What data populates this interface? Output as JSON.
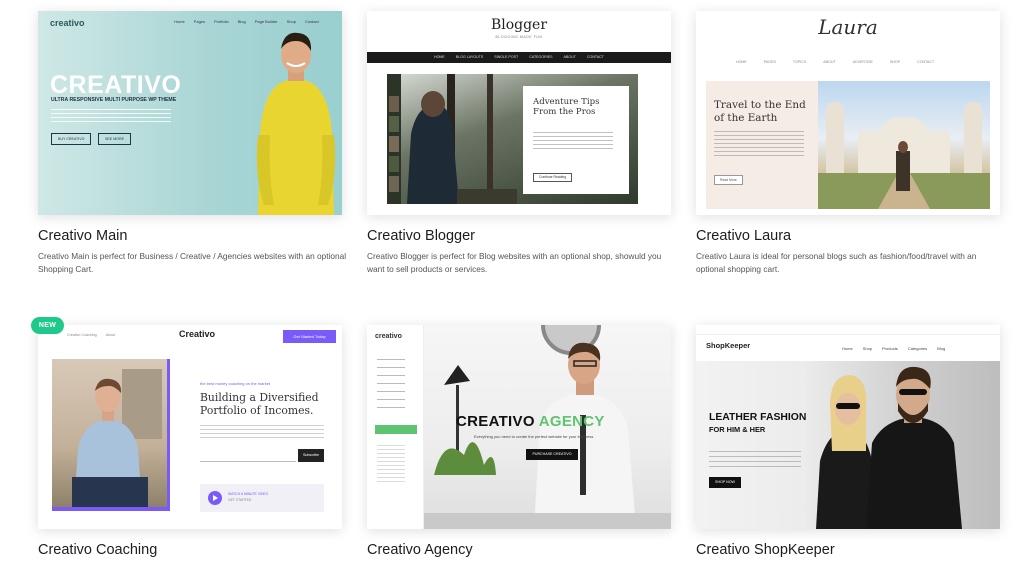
{
  "cards": [
    {
      "title": "Creativo Main",
      "description": "Creativo Main is perfect for Business / Creative / Agencies websites with an optional Shopping Cart.",
      "preview": {
        "logo": "creativo",
        "nav": [
          "Home",
          "Pages",
          "Portfolio",
          "Blog",
          "Page Builder",
          "Shop",
          "Contact"
        ],
        "hero_title": "CREATIVO",
        "hero_subtitle": "ULTRA RESPONSIVE MULTI PURPOSE WP THEME",
        "buttons": [
          "BUY CREATIVO",
          "SEE MORE"
        ]
      }
    },
    {
      "title": "Creativo Blogger",
      "description": "Creativo Blogger is perfect for Blog websites with an optional shop, showuld you want to sell products or services.",
      "preview": {
        "logo": "Blogger",
        "tagline": "BLOGGING MADE FUN",
        "nav": [
          "HOME",
          "BLOG LAYOUTS",
          "SINGLE POST",
          "CATEGORIES",
          "ABOUT",
          "CONTACT"
        ],
        "post_title": "Adventure Tips From the Pros",
        "post_button": "Continue Reading"
      }
    },
    {
      "title": "Creativo Laura",
      "description": "Creativo Laura is ideal for personal blogs such as fashion/food/travel with an optional shopping cart.",
      "preview": {
        "logo": "Laura",
        "nav": [
          "HOME",
          "PAGES",
          "TOPICS",
          "ABOUT",
          "ADVERTISE",
          "SHOP",
          "CONTACT"
        ],
        "post_title": "Travel to the End of the Earth",
        "post_button": "Read More"
      }
    },
    {
      "title": "Creativo Coaching",
      "description": "",
      "badge": "NEW",
      "preview": {
        "logo": "Creativo",
        "nav": [
          "Creativo Coaching",
          "About"
        ],
        "cta": "Get Started Today",
        "kicker": "the best money coaching on the market",
        "hero_title": "Building a Diversified Portfolio of Incomes.",
        "subscribe": "Subscribe",
        "video_label": "WATCH A MINUTE VIDEO",
        "video_sub": "GET STARTED"
      }
    },
    {
      "title": "Creativo Agency",
      "description": "",
      "preview": {
        "logo": "creativo",
        "hero_title_part1": "CREATIVO",
        "hero_title_part2": "AGENCY",
        "hero_subtitle": "Everything you need to create the perfect website for your business",
        "button": "PURCHASE CREATIVO"
      }
    },
    {
      "title": "Creativo ShopKeeper",
      "description": "",
      "preview": {
        "logo": "ShopKeeper",
        "nav": [
          "Home",
          "Shop",
          "Products",
          "Categories",
          "Blog"
        ],
        "hero_title": "LEATHER FASHION",
        "hero_subtitle": "FOR HIM & HER",
        "button": "SHOP NOW"
      }
    }
  ],
  "colors": {
    "accent_green": "#1fc98a",
    "coaching_purple": "#7a5af8",
    "agency_green": "#5fc471"
  }
}
